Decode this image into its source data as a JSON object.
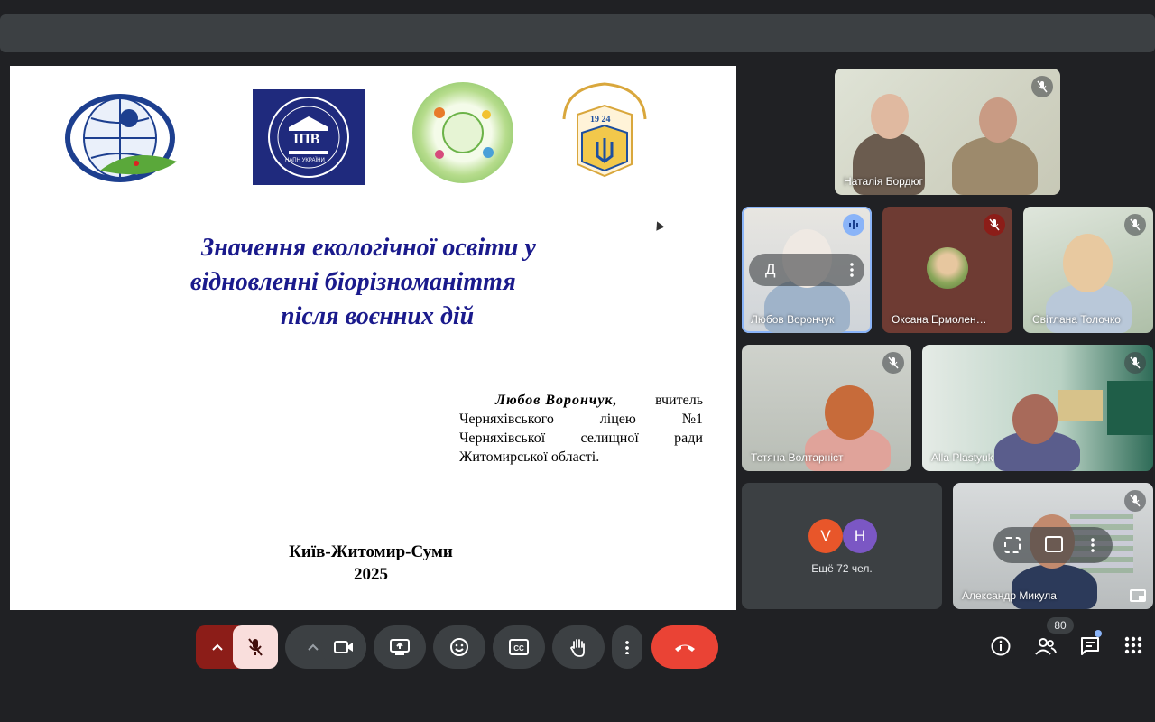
{
  "slide": {
    "title_lines": [
      "Значення екологічної освіти у",
      "відновленні біорізноманіття",
      "після воєнних дій"
    ],
    "author_name": "Любов Ворончук,",
    "author_role": "вчитель",
    "author_lines": [
      [
        "Черняхівського",
        "ліцею",
        "№1"
      ],
      [
        "Черняхівської",
        "селищної",
        "ради"
      ]
    ],
    "author_last": "Житомирської області.",
    "city": "Київ-Житомир-Суми",
    "year": "2025",
    "logos": {
      "ipv_text": "ІПВ",
      "ipv_sub": "НАПН УКРАЇНИ",
      "sumy_year": "19 24"
    }
  },
  "participants": [
    {
      "name": "Наталія Бордюг",
      "muted": true
    },
    {
      "name": "Любов Ворончук",
      "speaking": true
    },
    {
      "name": "Оксана Ермолен…",
      "muted": true
    },
    {
      "name": "Світлана Толочко",
      "muted": true
    },
    {
      "name": "Тетяна Волтарніст",
      "muted": true
    },
    {
      "name": "Alla Plastyuk",
      "muted": true
    },
    {
      "name": "Александр Микула",
      "muted": true
    }
  ],
  "more": {
    "label": "Ещё 72 чел.",
    "avatars": [
      "V",
      "H"
    ],
    "colors": [
      "#e8562a",
      "#7b57c4"
    ]
  },
  "tile_overlay": {
    "pin_label": "Д"
  },
  "people_count": "80",
  "colors": {
    "end_call": "#ea4335",
    "mic_active_bg": "#f9dedc",
    "mic_group_bg": "#8c1d18",
    "accent": "#8ab4f8"
  }
}
